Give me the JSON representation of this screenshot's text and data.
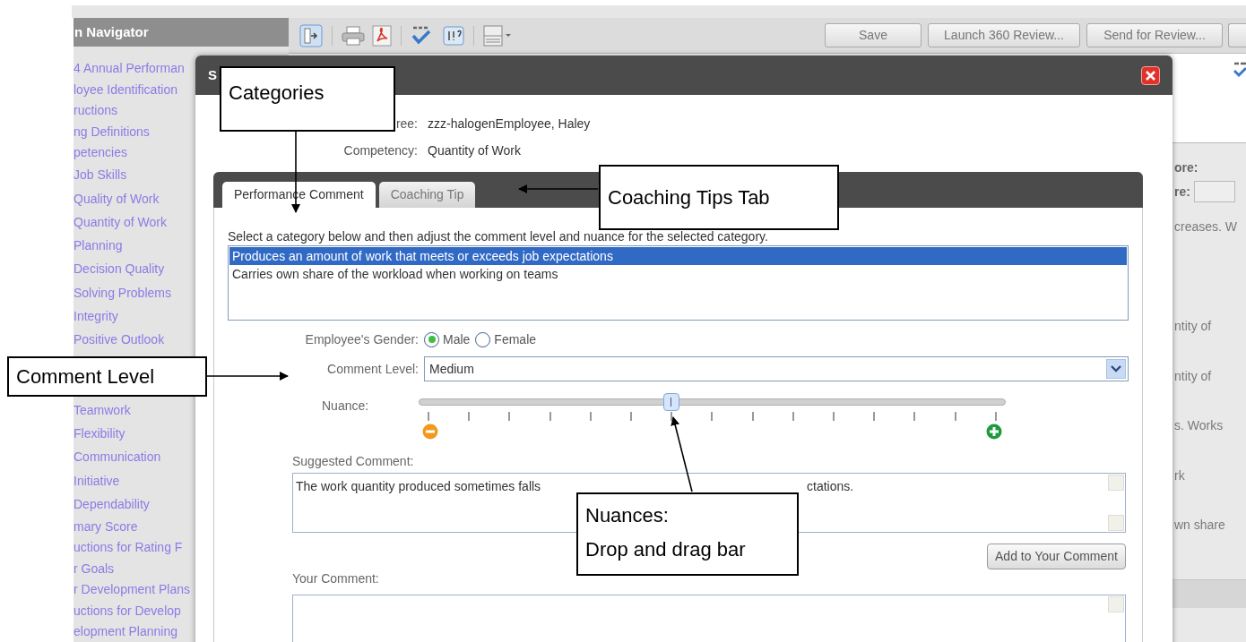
{
  "top_toolbar": {
    "buttons": [
      "Save",
      "Launch 360 Review...",
      "Send for Review..."
    ]
  },
  "sidebar": {
    "title": "n Navigator",
    "groups": [
      [
        {
          "label": "4 Annual Performan",
          "kind": "section"
        },
        {
          "label": "loyee Identification",
          "kind": "section"
        },
        {
          "label": "ructions",
          "kind": "section"
        },
        {
          "label": "ng Definitions",
          "kind": "section"
        },
        {
          "label": "petencies",
          "kind": "section"
        },
        {
          "label": "Job Skills",
          "kind": "item"
        },
        {
          "label": "Quality of Work",
          "kind": "item"
        },
        {
          "label": "Quantity of Work",
          "kind": "item"
        },
        {
          "label": "Planning",
          "kind": "item"
        },
        {
          "label": "Decision Quality",
          "kind": "item"
        },
        {
          "label": "Solving Problems",
          "kind": "item"
        },
        {
          "label": "Integrity",
          "kind": "item"
        },
        {
          "label": "Positive Outlook",
          "kind": "item"
        }
      ],
      [
        {
          "label": "Teamwork",
          "kind": "item"
        },
        {
          "label": "Flexibility",
          "kind": "item"
        },
        {
          "label": "Communication",
          "kind": "item"
        },
        {
          "label": "Initiative",
          "kind": "item"
        },
        {
          "label": "Dependability",
          "kind": "item"
        },
        {
          "label": "mary Score",
          "kind": "section"
        },
        {
          "label": "uctions for Rating F",
          "kind": "section"
        },
        {
          "label": "r Goals",
          "kind": "section"
        },
        {
          "label": "r Development Plans",
          "kind": "section"
        },
        {
          "label": "uctions for Develop",
          "kind": "section"
        },
        {
          "label": "elopment Planning",
          "kind": "section"
        }
      ]
    ]
  },
  "background_panel": {
    "texts": [
      {
        "text": "ore:",
        "kind": "label"
      },
      {
        "text": "re:",
        "kind": "field"
      },
      {
        "text": "creases. W",
        "kind": "text"
      },
      {
        "text": "ntity of",
        "kind": "text"
      },
      {
        "text": "ntity of",
        "kind": "text"
      },
      {
        "text": "s. Works",
        "kind": "text"
      },
      {
        "text": "rk",
        "kind": "text"
      },
      {
        "text": "wn share",
        "kind": "text"
      }
    ]
  },
  "dialog": {
    "title": "S",
    "fields": [
      {
        "label": "ree:",
        "value": "zzz-halogenEmployee, Haley"
      },
      {
        "label": "Competency:",
        "value": "Quantity of Work"
      }
    ],
    "tabs": [
      {
        "label": "Performance Comment",
        "selected": true
      },
      {
        "label": "Coaching Tip",
        "selected": false
      }
    ],
    "instruction": "Select a category below and then adjust the comment level and nuance for the selected category.",
    "categories": [
      {
        "text": "Produces an amount of work that meets or exceeds job expectations",
        "selected": true
      },
      {
        "text": "Carries own share of the workload when working on teams",
        "selected": false
      }
    ],
    "gender": {
      "label": "Employee's Gender:",
      "options": [
        {
          "label": "Male",
          "selected": true
        },
        {
          "label": "Female",
          "selected": false
        }
      ]
    },
    "comment_level": {
      "label": "Comment Level:",
      "value": "Medium"
    },
    "nuance": {
      "label": "Nuance:",
      "level": 0.43
    },
    "suggested_comment": {
      "label": "Suggested Comment:",
      "value_parts": [
        "The work quantity produced sometimes falls",
        "ctations."
      ]
    },
    "add_button": "Add to Your Comment",
    "your_comment": {
      "label": "Your Comment:"
    }
  },
  "callouts": [
    {
      "lines": [
        "Categories"
      ]
    },
    {
      "lines": [
        "Coaching Tips Tab"
      ]
    },
    {
      "lines": [
        "Comment Level"
      ]
    },
    {
      "lines": [
        "Nuances:",
        "Drop and drag bar"
      ]
    }
  ]
}
